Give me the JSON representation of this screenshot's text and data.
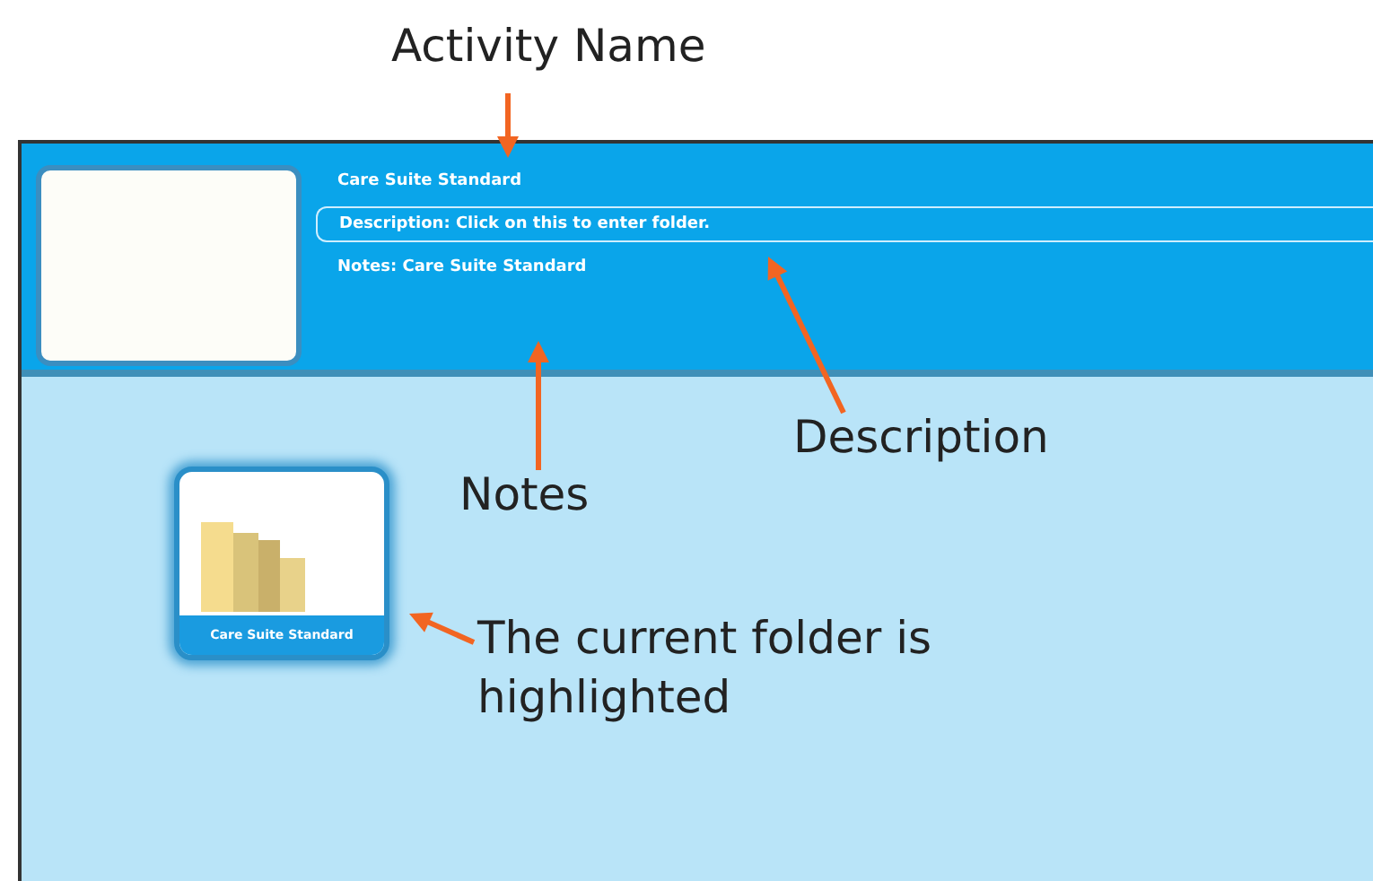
{
  "header": {
    "activity_name": "Care Suite Standard",
    "description": "Description: Click on this to enter folder.",
    "notes": "Notes: Care Suite Standard"
  },
  "folders": [
    {
      "label": "Care Suite Standard",
      "selected": true
    }
  ],
  "annotations": [
    {
      "kind": "activity",
      "label": "Activity Name"
    },
    {
      "kind": "description",
      "label": "Description"
    },
    {
      "kind": "notes",
      "label": "Notes"
    },
    {
      "kind": "folder",
      "label": "The current folder is highlighted"
    }
  ]
}
